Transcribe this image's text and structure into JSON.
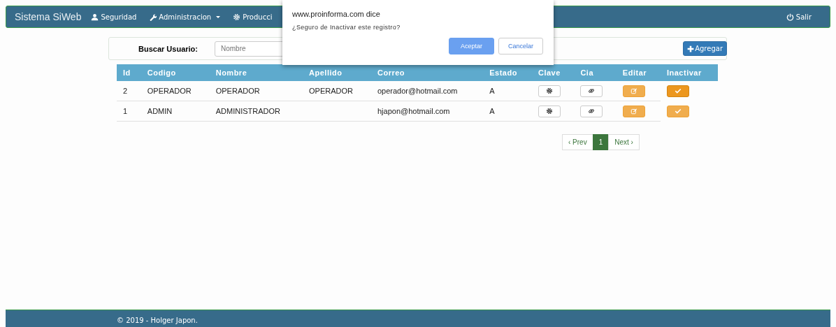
{
  "navbar": {
    "brand": "Sistema SiWeb",
    "items": [
      {
        "label": "Seguridad",
        "kind": "user",
        "dropdown": false
      },
      {
        "label": "Administracion",
        "kind": "tools",
        "dropdown": true
      },
      {
        "label": "Producci",
        "kind": "settings",
        "dropdown": false
      }
    ],
    "logout": "Salir"
  },
  "search": {
    "label": "Buscar Usuario:",
    "placeholder": "Nombre",
    "add_button": "Agregar"
  },
  "table": {
    "columns": [
      "Id",
      "Codigo",
      "Nombre",
      "Apellido",
      "Correo",
      "Estado",
      "Clave",
      "Cia",
      "Editar",
      "Inactivar"
    ],
    "rows": [
      {
        "cells": [
          "2",
          "OPERADOR",
          "OPERADOR",
          "OPERADOR",
          "operador@hotmail.com",
          "A"
        ],
        "inactivar_active": true
      },
      {
        "cells": [
          "1",
          "ADMIN",
          "ADMINISTRADOR",
          "",
          "hjapon@hotmail.com",
          "A"
        ],
        "inactivar_active": false
      }
    ]
  },
  "pagination": {
    "prev": "‹ Prev",
    "pages": [
      {
        "label": "1",
        "selected": true
      }
    ],
    "next": "Next ›"
  },
  "dialog": {
    "origin": "www.proinforma.com dice",
    "message": "¿Seguro de Inactivar este registro?",
    "ok": "Aceptar",
    "cancel": "Cancelar"
  },
  "footer": {
    "text": "© 2019 - Holger Japon."
  }
}
